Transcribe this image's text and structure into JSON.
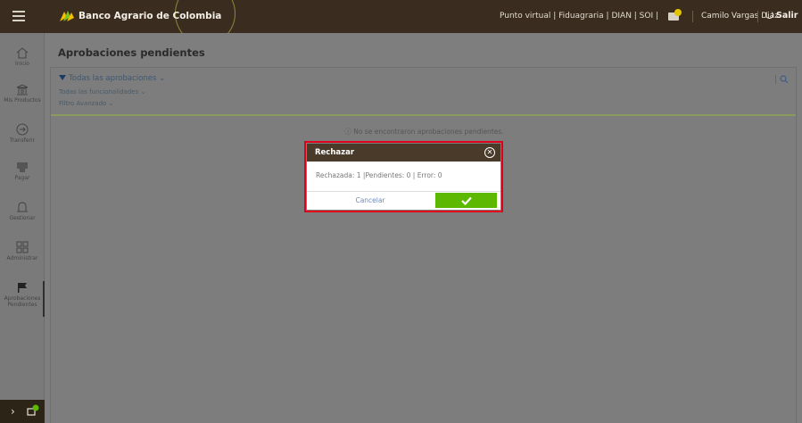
{
  "header": {
    "brand": "Banco Agrario de Colombia",
    "links": "Punto virtual | Fiduagraria | DIAN | SOI |",
    "user": "Camilo Vargas Diaz ⌄",
    "logout": "Salir"
  },
  "sidebar": {
    "items": [
      {
        "label": "Inicio",
        "icon": "home-icon"
      },
      {
        "label": "Mis Productos",
        "icon": "bank-icon"
      },
      {
        "label": "Transferir",
        "icon": "transfer-icon"
      },
      {
        "label": "Pagar",
        "icon": "pay-icon"
      },
      {
        "label": "Gestionar",
        "icon": "manage-icon"
      },
      {
        "label": "Administrar",
        "icon": "admin-grid-icon"
      },
      {
        "label": "Aprobaciones Pendientes",
        "icon": "flag-icon"
      }
    ],
    "footer_badge": "1"
  },
  "page": {
    "title": "Aprobaciones pendientes",
    "filter_all": "Todas las aprobaciones ⌄",
    "filter_features": "Todas las funcionalidades ⌄",
    "filter_advanced": "Filtro Avanzado ⌄",
    "empty_message": "ⓘ No se encontraron aprobaciones pendientes."
  },
  "modal": {
    "title": "Rechazar",
    "body": "Rechazada: 1 |Pendientes: 0 | Error: 0",
    "cancel_label": "Cancelar"
  },
  "colors": {
    "header_bg": "#3a2d1f",
    "modal_header": "#4a3a2a",
    "confirm_green": "#5cb800",
    "highlight_red": "#e1001a"
  }
}
